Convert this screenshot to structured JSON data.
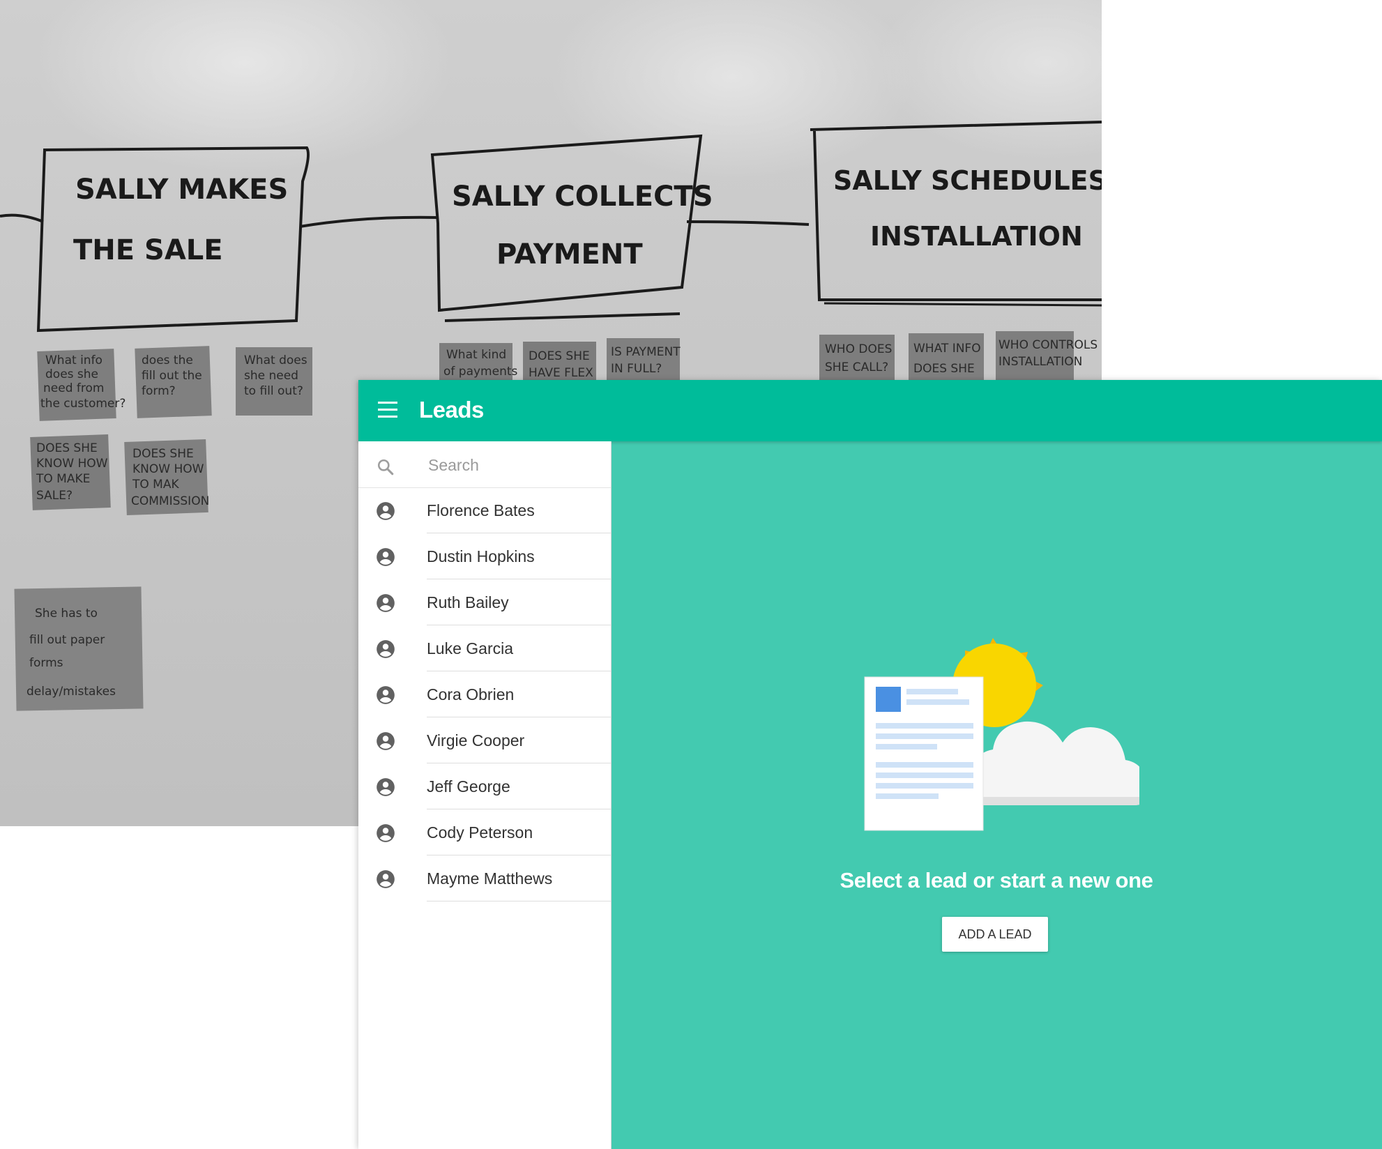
{
  "whiteboard": {
    "steps": [
      {
        "line1": "SALLY MAKES",
        "line2": "THE SALE"
      },
      {
        "line1": "SALLY COLLECTS",
        "line2": "PAYMENT"
      },
      {
        "line1": "SALLY SCHEDULES",
        "line2": "INSTALLATION"
      }
    ],
    "notes": {
      "n1": [
        "What info",
        "does she",
        "need from",
        "the customer?"
      ],
      "n2": [
        "does the",
        "fill out the",
        "form?"
      ],
      "n3": [
        "What does",
        "she need",
        "to fill out?"
      ],
      "n4": [
        "DOES SHE",
        "KNOW HOW",
        "TO MAKE",
        "SALE?"
      ],
      "n5": [
        "DOES SHE",
        "KNOW HOW",
        "TO MAK",
        "COMMISSION"
      ],
      "n6": [
        "She has to",
        "fill out paper",
        "forms",
        "delay/mistakes"
      ],
      "n7": [
        "What kind",
        "of payments"
      ],
      "n8": [
        "DOES SHE",
        "HAVE FLEX"
      ],
      "n9": [
        "IS PAYMENT",
        "IN FULL?"
      ],
      "n10": [
        "WHO DOES",
        "SHE CALL?"
      ],
      "n11": [
        "WHAT INFO",
        "DOES SHE"
      ],
      "n12": [
        "WHO CONTROLS",
        "INSTALLATION"
      ]
    }
  },
  "app": {
    "title": "Leads",
    "search": {
      "placeholder": "Search"
    },
    "leads": [
      "Florence Bates",
      "Dustin Hopkins",
      "Ruth Bailey",
      "Luke Garcia",
      "Cora Obrien",
      "Virgie Cooper",
      "Jeff George",
      "Cody Peterson",
      "Mayme Matthews"
    ],
    "empty_state": {
      "message": "Select a lead or start a new one",
      "button": "ADD A LEAD"
    },
    "colors": {
      "header": "#00bc9a",
      "content": "#43cab0",
      "sun": "#f9d600",
      "doc_accent": "#4a90e2"
    }
  }
}
